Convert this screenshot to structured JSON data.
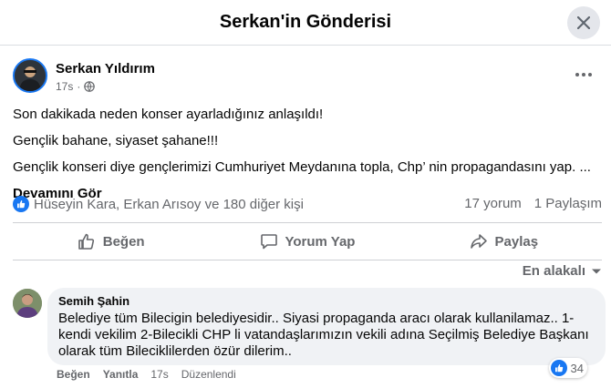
{
  "header": {
    "title": "Serkan'in Gönderisi",
    "close_icon": "close-icon"
  },
  "post": {
    "author": "Serkan Yıldırım",
    "time": "17s",
    "audience_icon": "globe-icon",
    "more_icon": "more-horizontal-icon",
    "paragraphs": [
      "Son dakikada neden konser ayarladığınız anlaşıldı!",
      "Gençlik bahane, siyaset şahane!!!",
      "Gençlik konseri diye gençlerimizi Cumhuriyet Meydanına topla, Chp’ nin propagandasını yap. ..."
    ],
    "see_more": "Devamını Gör"
  },
  "stats": {
    "reactions_text": "Hüseyin Kara, Erkan Arısoy ve 180 diğer kişi",
    "comments": "17 yorum",
    "shares": "1 Paylaşım",
    "like_color": "#1877f2"
  },
  "actions": {
    "like": "Beğen",
    "comment": "Yorum Yap",
    "share": "Paylaş"
  },
  "sort": {
    "label": "En alakalı"
  },
  "comment": {
    "author": "Semih Şahin",
    "text": "Belediye tüm Bilecigin belediyesidir.. Siyasi propaganda aracı olarak kullanilamaz.. 1-kendi vekilim 2-Bilecikli CHP li vatandaşlarımızın vekili adına Seçilmiş Belediye Başkanı olarak tüm Bileciklilerden özür dilerim..",
    "like_label": "Beğen",
    "reply_label": "Yanıtla",
    "time": "17s",
    "edited": "Düzenlendi",
    "reaction_count": "34"
  }
}
